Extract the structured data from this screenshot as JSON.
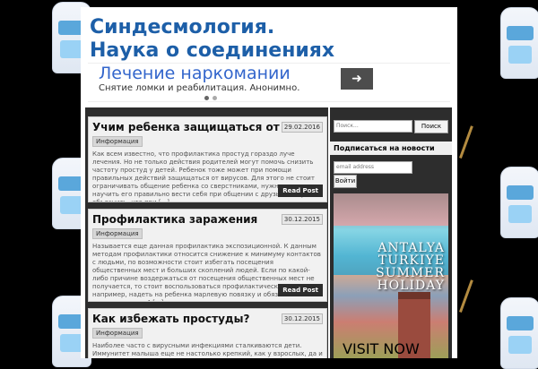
{
  "site": {
    "title": "Синдесмология. Наука о соединениях костей."
  },
  "ad_banner": {
    "title": "Лечение наркомании",
    "text": "Снятие ломки и реабилитация. Анонимно. Долговременный результат!",
    "arrow": "➜"
  },
  "posts": [
    {
      "title": "Учим ребенка защищаться от простуд",
      "date": "29.02.2016",
      "category": "Информация",
      "excerpt": "Как всем известно, что профилактика простуд гораздо луче лечения. Но не только действия родителей могут помочь снизить частоту простуд у детей. Ребенок тоже может при помощи правильных действий защищаться от вирусов. Для этого не стоит ограничивать общение ребенка со сверстниками, нужно просто научить его правильно вести себя при общении с друзьями. Нужно объяснить, что при [...]",
      "read_more": "Read Post"
    },
    {
      "title": "Профилактика заражения",
      "date": "30.12.2015",
      "category": "Информация",
      "excerpt": "Называется еще данная профилактика экспозиционной. К данным методам профилактики относится снижение к минимуму контактов с людьми, по возможности стоит избегать посещения общественных мест и больших скоплений людей. Если по какой-либо причине воздержаться от посещения общественных мест не получается, то стоит воспользоваться профилактическими мерами, например, надеть на ребенка марлевую повязку и обязательно ее менять каждые 4 [...]",
      "read_more": "Read Post"
    },
    {
      "title": "Как избежать простуды?",
      "date": "30.12.2015",
      "category": "Информация",
      "excerpt": "Наиболее часто с вирусными инфекциями сталкиваются дети. Иммунитет малыша еще не настолько крепкий, как у взрослых, да и посещение детских садов, школ, общественных мест, тоже сказывается. Поэтому на первом месте, конечно, профилактика вирусных инфекций. Профилактика основывается на общем"
    }
  ],
  "sidebar": {
    "search_placeholder": "Поиск...",
    "search_button": "Поиск",
    "subscribe_title": "Подписаться на новости",
    "email_placeholder": "email address",
    "subscribe_button": "Войти",
    "promo": {
      "line1": "ANTALYA",
      "line2": "TURKIYE",
      "line3": "SUMMER",
      "line4": "HOLIDAY",
      "bottom": "VISIT NOW"
    }
  },
  "colors": {
    "accent": "#1d5fa8",
    "dark": "#2d2d2d",
    "link": "#3366cc"
  }
}
